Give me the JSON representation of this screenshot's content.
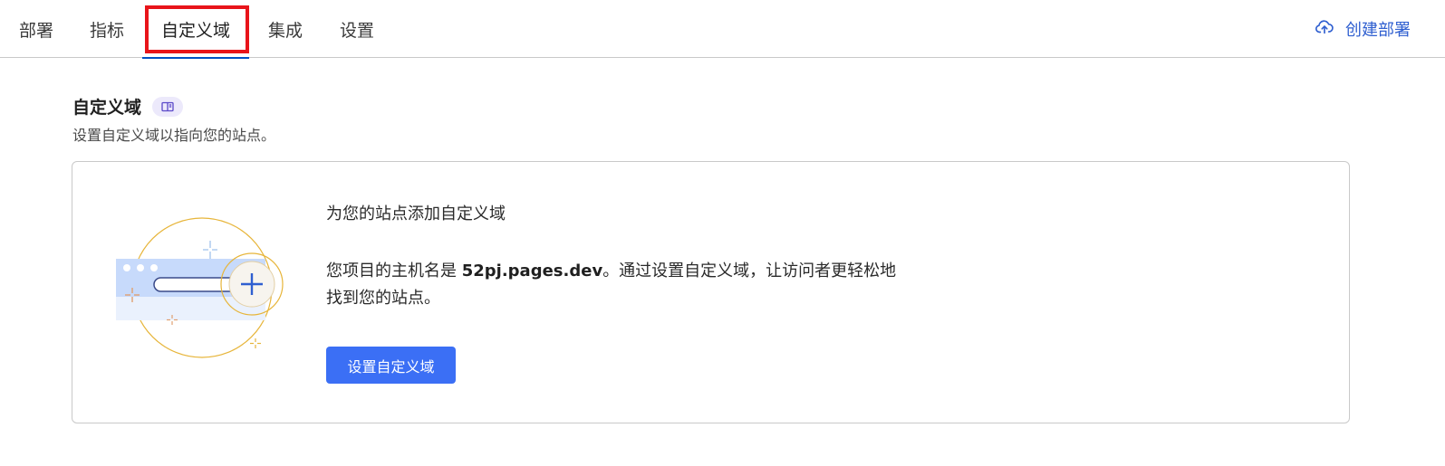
{
  "tabs": [
    {
      "label": "部署"
    },
    {
      "label": "指标"
    },
    {
      "label": "自定义域"
    },
    {
      "label": "集成"
    },
    {
      "label": "设置"
    }
  ],
  "header_action": {
    "label": "创建部署",
    "icon": "cloud-upload-icon"
  },
  "section": {
    "title": "自定义域",
    "badge_icon": "docs-book-icon",
    "description": "设置自定义域以指向您的站点。"
  },
  "card": {
    "heading": "为您的站点添加自定义域",
    "body_prefix": "您项目的主机名是 ",
    "hostname": "52pj.pages.dev",
    "body_suffix": "。通过设置自定义域，让访问者更轻松地找到您的站点。",
    "button_label": "设置自定义域",
    "illustration_icon": "add-domain-illustration"
  },
  "colors": {
    "accent": "#0051c3",
    "button": "#3b6ff5",
    "highlight": "#e8141a",
    "link": "#2f5fd0"
  }
}
